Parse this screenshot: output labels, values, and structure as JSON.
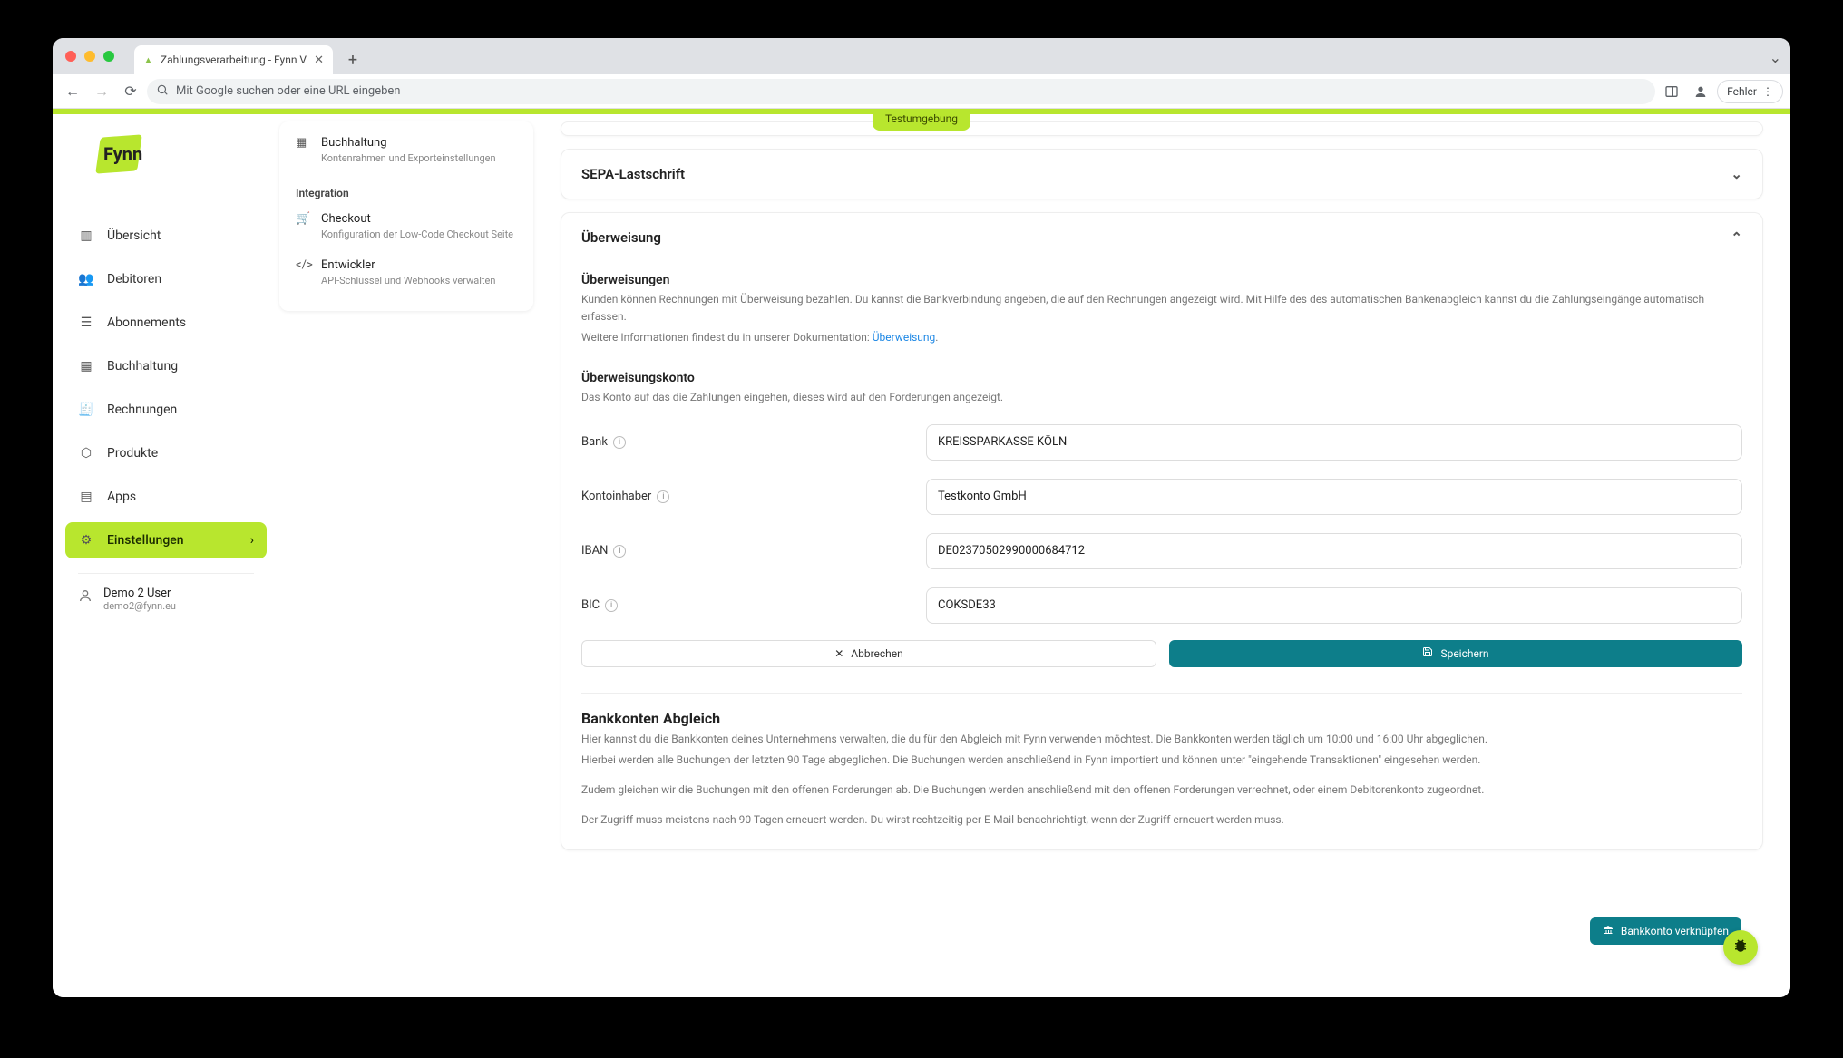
{
  "browser": {
    "tab_title": "Zahlungsverarbeitung - Fynn V",
    "omnibox_placeholder": "Mit Google suchen oder eine URL eingeben",
    "error_chip": "Fehler"
  },
  "env_badge": "Testumgebung",
  "logo_text": "Fynn",
  "sidebar": {
    "items": [
      {
        "label": "Übersicht"
      },
      {
        "label": "Debitoren"
      },
      {
        "label": "Abonnements"
      },
      {
        "label": "Buchhaltung"
      },
      {
        "label": "Rechnungen"
      },
      {
        "label": "Produkte"
      },
      {
        "label": "Apps"
      },
      {
        "label": "Einstellungen"
      }
    ],
    "user": {
      "name": "Demo 2 User",
      "email": "demo2@fynn.eu"
    }
  },
  "subnav": {
    "items_top": [
      {
        "title": "Buchhaltung",
        "desc": "Kontenrahmen und Exporteinstellungen"
      }
    ],
    "section_label": "Integration",
    "items_bottom": [
      {
        "title": "Checkout",
        "desc": "Konfiguration der Low-Code Checkout Seite"
      },
      {
        "title": "Entwickler",
        "desc": "API-Schlüssel und Webhooks verwalten"
      }
    ]
  },
  "panels": {
    "sepa": {
      "title": "SEPA-Lastschrift"
    },
    "ueberweisung": {
      "title": "Überweisung",
      "sec1_title": "Überweisungen",
      "sec1_desc": "Kunden können Rechnungen mit Überweisung bezahlen. Du kannst die Bankverbindung angeben, die auf den Rechnungen angezeigt wird. Mit Hilfe des des automatischen Bankenabgleich kannst du die Zahlungseingänge automatisch erfassen.",
      "sec1_doc_prefix": "Weitere Informationen findest du in unserer Dokumentation: ",
      "sec1_doc_link": "Überweisung",
      "sec2_title": "Überweisungskonto",
      "sec2_desc": "Das Konto auf das die Zahlungen eingehen, dieses wird auf den Forderungen angezeigt.",
      "fields": {
        "bank_label": "Bank",
        "bank_value": "KREISSPARKASSE KÖLN",
        "holder_label": "Kontoinhaber",
        "holder_value": "Testkonto GmbH",
        "iban_label": "IBAN",
        "iban_value": "DE02370502990000684712",
        "bic_label": "BIC",
        "bic_value": "COKSDE33"
      },
      "cancel": "Abbrechen",
      "save": "Speichern"
    },
    "abgleich": {
      "title": "Bankkonten Abgleich",
      "p1": "Hier kannst du die Bankkonten deines Unternehmens verwalten, die du für den Abgleich mit Fynn verwenden möchtest. Die Bankkonten werden täglich um 10:00 und 16:00 Uhr abgeglichen.",
      "p2": "Hierbei werden alle Buchungen der letzten 90 Tage abgeglichen. Die Buchungen werden anschließend in Fynn importiert und können unter \"eingehende Transaktionen\" eingesehen werden.",
      "p3": "Zudem gleichen wir die Buchungen mit den offenen Forderungen ab. Die Buchungen werden anschließend mit den offenen Forderungen verrechnet, oder einem Debitorenkonto zugeordnet.",
      "p4": "Der Zugriff muss meistens nach 90 Tagen erneuert werden. Du wirst rechtzeitig per E-Mail benachrichtigt, wenn der Zugriff erneuert werden muss.",
      "link_button": "Bankkonto verknüpfen"
    }
  }
}
